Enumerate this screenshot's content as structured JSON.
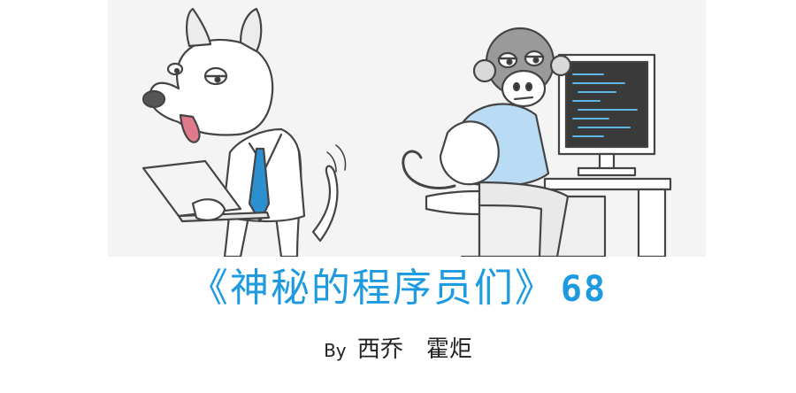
{
  "title": {
    "text": "《神秘的程序员们》",
    "issue": "68",
    "accent_color": "#1e9be0"
  },
  "byline": {
    "by": "By",
    "author_1": "西乔",
    "author_2": "霍炬"
  },
  "illustration": {
    "characters": [
      "dog-with-laptop",
      "monkey-at-computer"
    ],
    "icons": [
      "laptop-icon",
      "monitor-icon",
      "chair-icon",
      "desk-icon"
    ]
  }
}
